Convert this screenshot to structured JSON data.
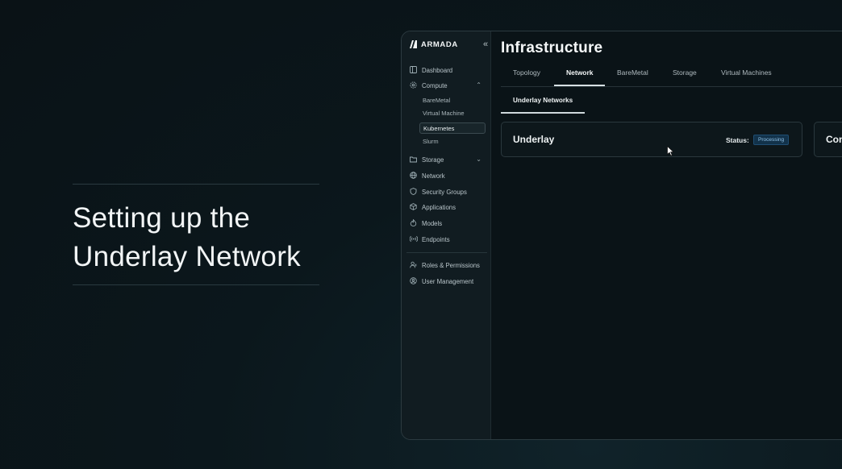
{
  "intro": {
    "line1": "Setting up the",
    "line2": "Underlay Network"
  },
  "app": {
    "brand": "ARMADA",
    "sidebar": {
      "collapse_glyph": "«",
      "items": [
        {
          "label": "Dashboard",
          "icon": "dashboard-icon"
        },
        {
          "label": "Compute",
          "icon": "gear-icon",
          "expanded": true
        },
        {
          "label": "Storage",
          "icon": "folder-icon"
        },
        {
          "label": "Network",
          "icon": "globe-icon"
        },
        {
          "label": "Security Groups",
          "icon": "shield-icon"
        },
        {
          "label": "Applications",
          "icon": "cube-icon"
        },
        {
          "label": "Models",
          "icon": "flame-icon"
        },
        {
          "label": "Endpoints",
          "icon": "broadcast-icon"
        },
        {
          "label": "Roles & Permissions",
          "icon": "users-icon"
        },
        {
          "label": "User Management",
          "icon": "user-gear-icon"
        }
      ],
      "compute_sub": [
        "BareMetal",
        "Virtual Machine",
        "Kubernetes",
        "Slurm"
      ],
      "active_sub": "Kubernetes"
    },
    "main": {
      "title": "Infrastructure",
      "tabs": [
        "Topology",
        "Network",
        "BareMetal",
        "Storage",
        "Virtual Machines"
      ],
      "active_tab": "Network",
      "subtab": "Underlay Networks",
      "cards": [
        {
          "title": "Underlay",
          "status_label": "Status:",
          "status": "Processing"
        },
        {
          "title": "Con"
        }
      ]
    }
  },
  "colors": {
    "background": "#0b1418",
    "accent": "#12324a",
    "badge_text": "#8fc1e6"
  }
}
